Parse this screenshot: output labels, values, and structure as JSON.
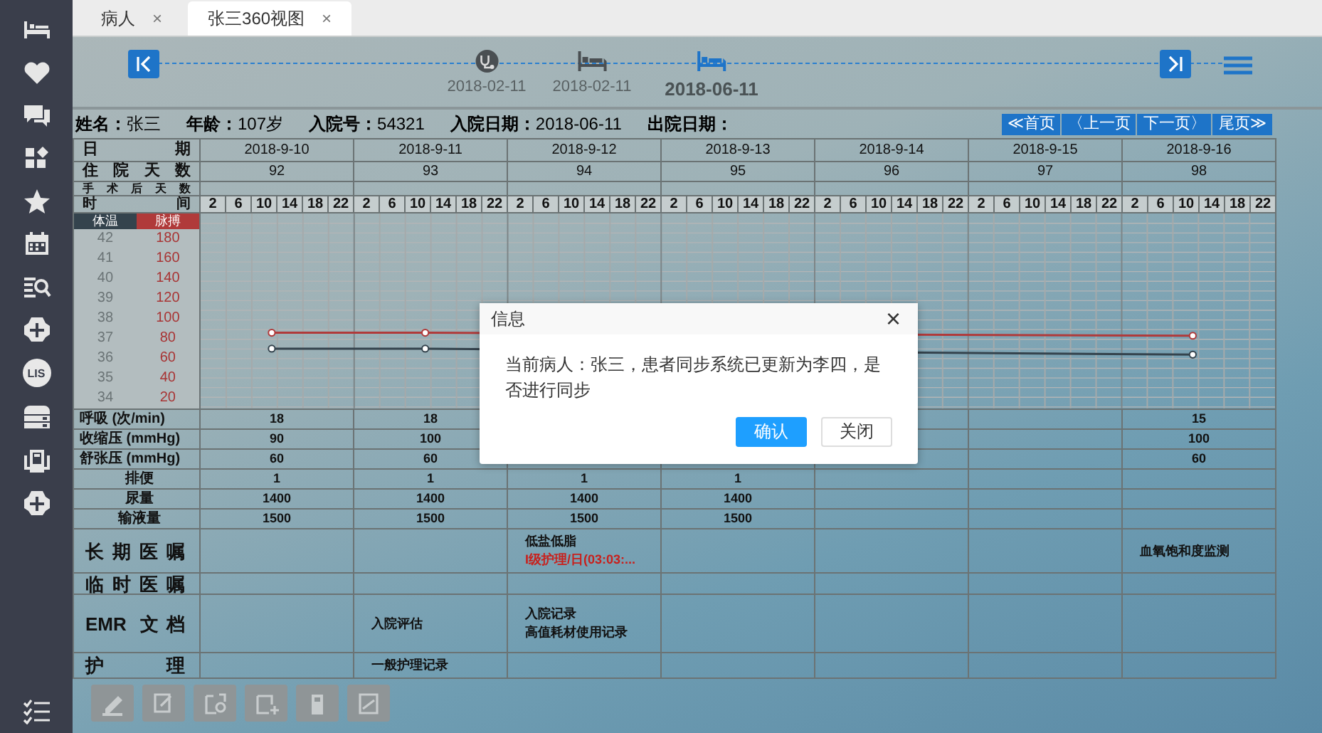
{
  "tabs": [
    {
      "label": "病人",
      "selected": false,
      "close": "×"
    },
    {
      "label": "张三360视图",
      "selected": true,
      "close": "×"
    }
  ],
  "sidebar": {
    "lis_badge": "LIS"
  },
  "timeline": {
    "events": [
      {
        "kind": "visit",
        "date": "2018-02-11",
        "selected": false
      },
      {
        "kind": "admission",
        "date": "2018-02-11",
        "selected": false
      },
      {
        "kind": "admission",
        "date": "2018-06-11",
        "selected": true
      }
    ]
  },
  "patient": [
    {
      "label": "姓名：",
      "value": "张三"
    },
    {
      "label": "年龄：",
      "value": "107岁"
    },
    {
      "label": "入院号：",
      "value": "54321"
    },
    {
      "label": "入院日期：",
      "value": "2018-06-11"
    },
    {
      "label": "出院日期："
    }
  ],
  "pager": [
    "≪首页",
    "〈上一页",
    "下一页〉",
    "尾页≫"
  ],
  "table": {
    "row_labels": [
      "日期",
      "住院天数",
      "手术后天数",
      "时间"
    ],
    "dates": [
      "2018-9-10",
      "2018-9-11",
      "2018-9-12",
      "2018-9-13",
      "2018-9-14",
      "2018-9-15",
      "2018-9-16"
    ],
    "hospital_days": [
      "92",
      "93",
      "94",
      "95",
      "96",
      "97",
      "98"
    ],
    "hours": [
      "2",
      "6",
      "10",
      "14",
      "18",
      "22",
      "2",
      "6",
      "10",
      "14",
      "18",
      "22",
      "2",
      "6",
      "10",
      "14",
      "18",
      "22",
      "2",
      "6",
      "10",
      "14",
      "18",
      "22",
      "2",
      "6",
      "10",
      "14",
      "18",
      "22",
      "2",
      "6",
      "10",
      "14",
      "18",
      "22",
      "2",
      "6",
      "10",
      "14",
      "18",
      "22"
    ],
    "chart_data": {
      "type": "line",
      "grid": true,
      "ylim": [
        20,
        180
      ],
      "yticks": [
        180,
        160,
        140,
        120,
        100,
        80,
        60,
        40,
        20
      ],
      "y2lim": [
        34,
        42
      ],
      "y2ticks": [
        42,
        41,
        40,
        39,
        38,
        37,
        36,
        35,
        34
      ],
      "series": [
        {
          "name": "体温",
          "color": "#34434d",
          "axis": "y2",
          "marker": "circle",
          "values": [
            36.5,
            36.5,
            null,
            null,
            null,
            null,
            36.2
          ]
        },
        {
          "name": "脉搏",
          "color": "#b03a3a",
          "axis": "y",
          "marker": "circle",
          "values": [
            86,
            86,
            null,
            null,
            null,
            null,
            83
          ]
        }
      ]
    },
    "vitals": [
      {
        "label": "呼吸 (次/min)",
        "kind": "measure",
        "cells": [
          {
            "text": "18"
          },
          {
            "text": "18"
          },
          {},
          {},
          {},
          {},
          {
            "text": "15"
          }
        ]
      },
      {
        "label": "收缩压 (mmHg)",
        "kind": "measure",
        "cells": [
          {
            "text": "90"
          },
          {
            "text": "100"
          },
          {},
          {},
          {},
          {},
          {
            "text": "100"
          }
        ]
      },
      {
        "label": "舒张压 (mmHg)",
        "kind": "measure",
        "cells": [
          {
            "text": "60"
          },
          {
            "text": "60"
          },
          {},
          {},
          {},
          {},
          {
            "text": "60"
          }
        ]
      },
      {
        "label": "排便",
        "kind": "count",
        "cells": [
          {
            "text": "1"
          },
          {
            "text": "1"
          },
          {
            "text": "1"
          },
          {
            "text": "1"
          },
          {},
          {},
          {}
        ]
      },
      {
        "label": "尿量",
        "kind": "count",
        "cells": [
          {
            "text": "1400"
          },
          {
            "text": "1400"
          },
          {
            "text": "1400"
          },
          {
            "text": "1400"
          },
          {},
          {},
          {}
        ]
      },
      {
        "label": "输液量",
        "kind": "count",
        "cells": [
          {
            "text": "1500"
          },
          {
            "text": "1500"
          },
          {
            "text": "1500"
          },
          {
            "text": "1500"
          },
          {},
          {},
          {}
        ]
      }
    ],
    "records": [
      {
        "label": "长期医嘱",
        "kind": "tall",
        "cells": [
          [],
          [],
          [
            {
              "text": "低盐低脂",
              "kind": "normal"
            },
            {
              "text": "I级护理/日(03:03:...",
              "kind": "alert"
            }
          ],
          [],
          [],
          [],
          [
            {
              "text": "血氧饱和度监测",
              "kind": "normal"
            }
          ]
        ]
      },
      {
        "label": "临时医嘱",
        "kind": "short",
        "cells": [
          [],
          [],
          [],
          [],
          [],
          [],
          []
        ]
      },
      {
        "label": "EMR 文档",
        "kind": "big",
        "cells": [
          [],
          [
            {
              "text": "入院评估",
              "kind": "normal"
            }
          ],
          [
            {
              "text": "入院记录",
              "kind": "normal"
            },
            {
              "text": "高值耗材使用记录",
              "kind": "normal"
            }
          ],
          [],
          [],
          [],
          []
        ]
      },
      {
        "label": "护理",
        "kind": "short",
        "cells": [
          [],
          [
            {
              "text": "一般护理记录",
              "kind": "normal"
            }
          ],
          [],
          [],
          [],
          [],
          []
        ]
      }
    ]
  },
  "dialog": {
    "title": "信息",
    "close": "×",
    "message": "当前病人：张三，患者同步系统已更新为李四，是否进行同步",
    "buttons": [
      {
        "label": "确认",
        "kind": "primary"
      },
      {
        "label": "关闭",
        "kind": "secondary"
      }
    ]
  }
}
